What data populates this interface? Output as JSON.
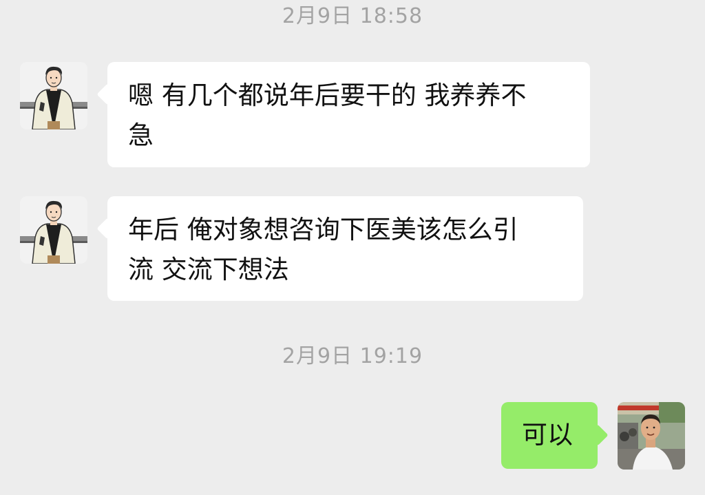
{
  "chat": {
    "timestamps": [
      "2月9日 18:58",
      "2月9日 19:19"
    ],
    "messages": [
      {
        "sender": "contact",
        "text": "嗯 有几个都说年后要干的 我养养不\n急"
      },
      {
        "sender": "contact",
        "text": "年后 俺对象想咨询下医美该怎么引\n流 交流下想法"
      },
      {
        "sender": "me",
        "text": "可以"
      }
    ]
  },
  "colors": {
    "background": "#ededed",
    "incoming_bubble": "#ffffff",
    "outgoing_bubble": "#95ec69",
    "timestamp_text": "#a3a3a3"
  },
  "icons": {
    "contact_avatar": "cartoon-man-avatar-icon",
    "my_avatar": "photo-man-avatar-icon"
  }
}
